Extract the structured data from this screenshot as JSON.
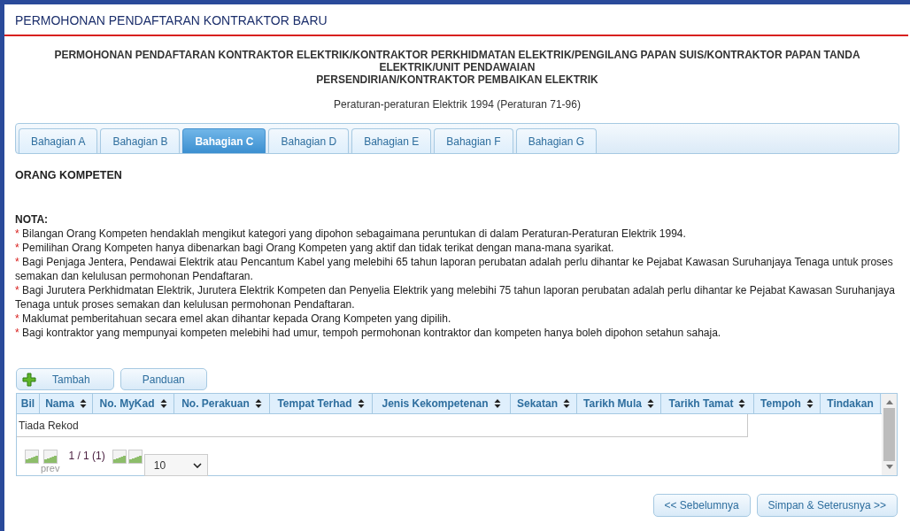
{
  "page_title": "PERMOHONAN PENDAFTARAN KONTRAKTOR BARU",
  "heading_lines": [
    "PERMOHONAN PENDAFTARAN KONTRAKTOR ELEKTRIK/KONTRAKTOR PERKHIDMATAN ELEKTRIK/PENGILANG PAPAN SUIS/KONTRAKTOR PAPAN TANDA",
    "ELEKTRIK/UNIT PENDAWAIAN",
    "PERSENDIRIAN/KONTRAKTOR PEMBAIKAN ELEKTRIK"
  ],
  "subheading": "Peraturan-peraturan Elektrik 1994 (Peraturan 71-96)",
  "tabs": [
    {
      "label": "Bahagian A",
      "selected": false
    },
    {
      "label": "Bahagian B",
      "selected": false
    },
    {
      "label": "Bahagian C",
      "selected": true
    },
    {
      "label": "Bahagian D",
      "selected": false
    },
    {
      "label": "Bahagian E",
      "selected": false
    },
    {
      "label": "Bahagian F",
      "selected": false
    },
    {
      "label": "Bahagian G",
      "selected": false
    }
  ],
  "section_title": "ORANG KOMPETEN",
  "notes": {
    "title": "NOTA:",
    "items": [
      {
        "marker": "*",
        "text": "Bilangan Orang Kompeten hendaklah mengikut kategori yang dipohon sebagaimana peruntukan di dalam Peraturan-Peraturan Elektrik 1994."
      },
      {
        "marker": "*",
        "text": "Pemilihan Orang Kompeten hanya dibenarkan bagi Orang Kompeten yang aktif dan tidak terikat dengan mana-mana syarikat."
      },
      {
        "marker": "*",
        "text": "Bagi Penjaga Jentera, Pendawai Elektrik atau Pencantum Kabel yang melebihi 65 tahun laporan perubatan adalah perlu dihantar ke Pejabat Kawasan Suruhanjaya Tenaga untuk proses semakan dan kelulusan permohonan Pendaftaran."
      },
      {
        "marker": "*",
        "text": "Bagi Jurutera Perkhidmatan Elektrik, Jurutera Elektrik Kompeten dan Penyelia Elektrik yang melebihi 75 tahun laporan perubatan adalah perlu dihantar ke Pejabat Kawasan Suruhanjaya Tenaga untuk proses semakan dan kelulusan permohonan Pendaftaran."
      },
      {
        "marker": "*",
        "text": "Maklumat pemberitahuan secara emel akan dihantar kepada Orang Kompeten yang dipilih."
      },
      {
        "marker": "*",
        "text": "Bagi kontraktor yang mempunyai kompeten melebihi had umur, tempoh permohonan kontraktor dan kompeten hanya boleh dipohon setahun sahaja."
      }
    ]
  },
  "toolbar_buttons": [
    {
      "label": "Tambah",
      "kind": "add"
    },
    {
      "label": "Panduan",
      "kind": "plain"
    }
  ],
  "table": {
    "columns": [
      {
        "label": "Bil",
        "sortable": false
      },
      {
        "label": "Nama",
        "sortable": true
      },
      {
        "label": "No. MyKad",
        "sortable": true
      },
      {
        "label": "No. Perakuan",
        "sortable": true
      },
      {
        "label": "Tempat Terhad",
        "sortable": true
      },
      {
        "label": "Jenis Kekompetenan",
        "sortable": true
      },
      {
        "label": "Sekatan",
        "sortable": true
      },
      {
        "label": "Tarikh Mula",
        "sortable": true
      },
      {
        "label": "Tarikh Tamat",
        "sortable": true
      },
      {
        "label": "Tempoh",
        "sortable": true
      },
      {
        "label": "Tindakan",
        "sortable": false
      }
    ],
    "empty_message": "Tiada Rekod",
    "pager": {
      "prev_alt": "prev",
      "page_info": "1 / 1 (1)",
      "page_size": "10"
    }
  },
  "nav_buttons": [
    "<< Sebelumnya",
    "Simpan & Seterusnya >>"
  ]
}
